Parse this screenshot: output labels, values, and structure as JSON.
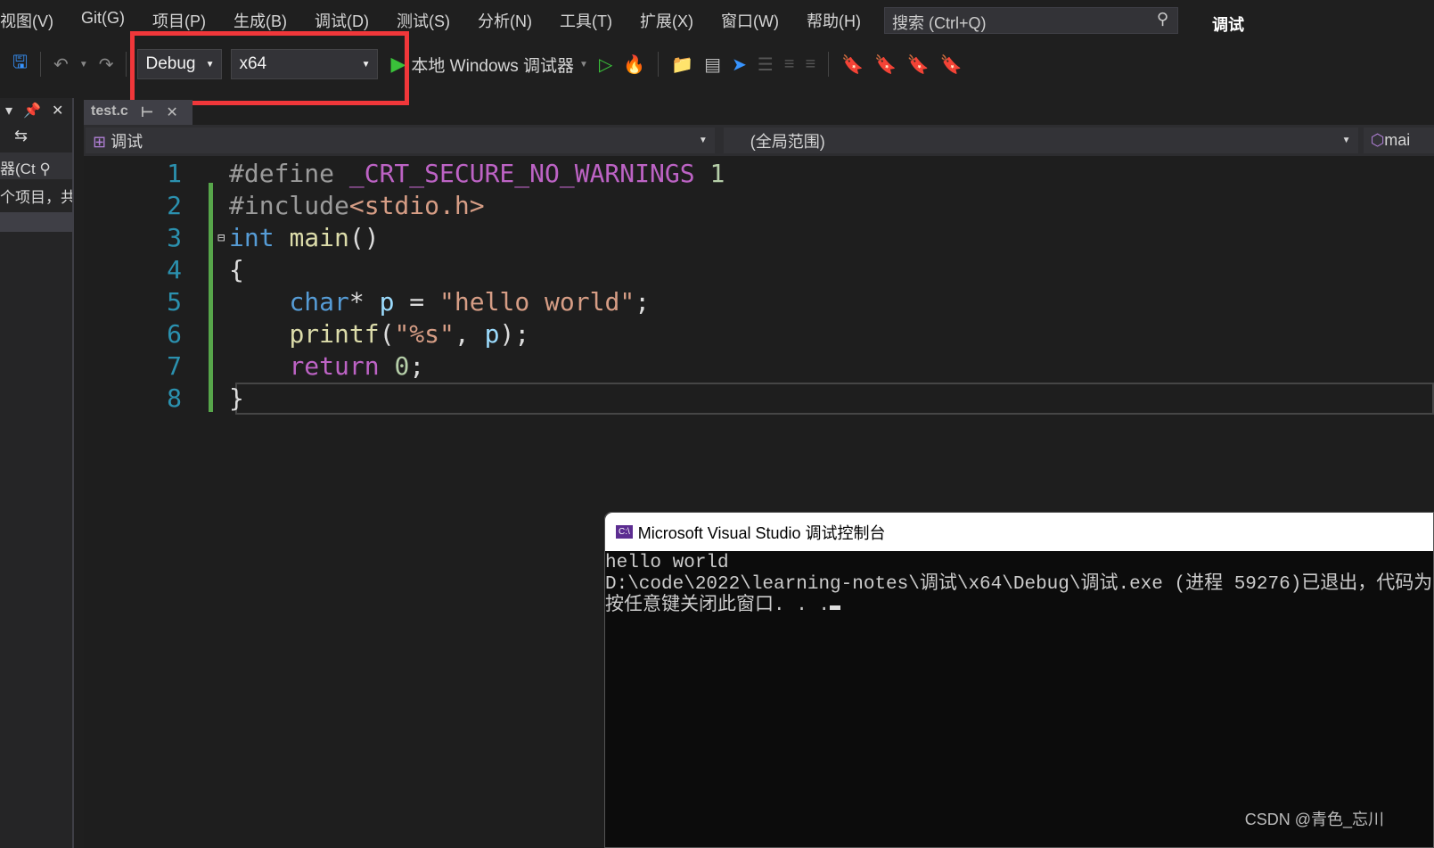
{
  "menu": [
    "视图(V)",
    "Git(G)",
    "项目(P)",
    "生成(B)",
    "调试(D)",
    "测试(S)",
    "分析(N)",
    "工具(T)",
    "扩展(X)",
    "窗口(W)",
    "帮助(H)"
  ],
  "search": {
    "placeholder": "搜索 (Ctrl+Q)"
  },
  "window_title": "调试",
  "toolbar": {
    "config": "Debug",
    "platform": "x64",
    "run_label": "本地 Windows 调试器"
  },
  "left_panel": {
    "search_text": "器(Ct",
    "info": "个项目，共"
  },
  "tab": {
    "name": "test.c"
  },
  "nav": {
    "project": "调试",
    "scope": "(全局范围)",
    "member": "mai"
  },
  "code": {
    "line_numbers": [
      "1",
      "2",
      "3",
      "4",
      "5",
      "6",
      "7",
      "8"
    ]
  },
  "console": {
    "title": "Microsoft Visual Studio 调试控制台",
    "lines": [
      "hello world",
      "D:\\code\\2022\\learning-notes\\调试\\x64\\Debug\\调试.exe (进程 59276)已退出，代码为",
      "按任意键关闭此窗口. . ."
    ]
  },
  "watermark": "CSDN @青色_忘川",
  "colors": {
    "highlight": "#f0373a",
    "accent": "#569cd6"
  }
}
